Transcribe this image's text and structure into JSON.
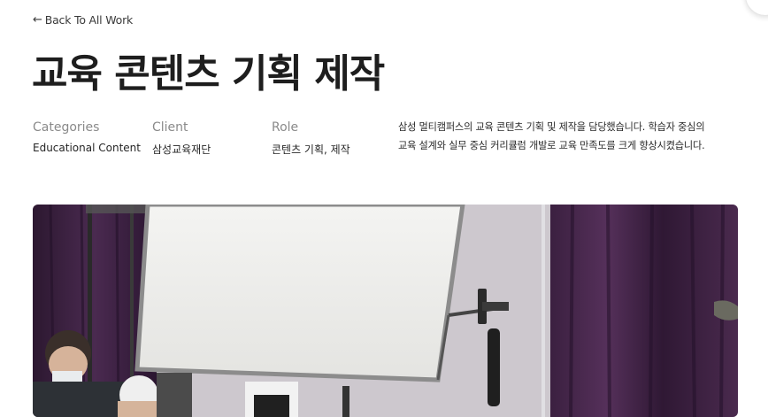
{
  "nav": {
    "back_arrow": "←",
    "back_label": "Back To All Work"
  },
  "project": {
    "title": "교육 콘텐츠 기획 제작",
    "categories_label": "Categories",
    "categories_value": "Educational Content",
    "client_label": "Client",
    "client_value": "삼성교육재단",
    "role_label": "Role",
    "role_value": "콘텐츠 기획, 제작",
    "description_line1": "삼성 멀티캠퍼스의 교육 콘텐츠 기획 및 제작을 담당했습니다. 학습자 중심의",
    "description_line2": "교육 설계와 실무 중심 커리큘럼 개발로 교육 만족도를 크게 향상시켰습니다."
  },
  "icons": {
    "back": "left-arrow-icon"
  },
  "colors": {
    "text": "#1e1e1e",
    "muted": "#8a8a8a",
    "curtain": "#3a1f3f",
    "wall": "#cfcbd1"
  }
}
